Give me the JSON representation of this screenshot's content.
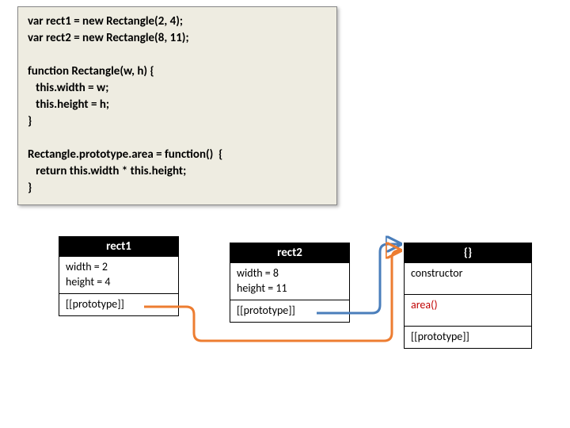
{
  "code": "var rect1 = new Rectangle(2, 4);\nvar rect2 = new Rectangle(8, 11);\n\nfunction Rectangle(w, h) {\n   this.width = w;\n   this.height = h;\n}\n\nRectangle.prototype.area = function()  {\n   return this.width * this.height;\n}",
  "rect1": {
    "title": "rect1",
    "props": "width = 2\nheight = 4",
    "proto": "[[prototype]]"
  },
  "rect2": {
    "title": "rect2",
    "props": "width = 8\nheight = 11",
    "proto": "[[prototype]]"
  },
  "protoObj": {
    "title": "{}",
    "constructor_label": "constructor",
    "area_label": "area()",
    "proto": "[[prototype]]"
  }
}
